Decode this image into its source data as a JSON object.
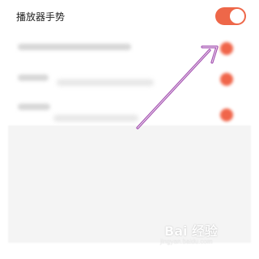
{
  "setting": {
    "title": "播放器手势",
    "toggle_on": true
  },
  "colors": {
    "accent": "#f0654a",
    "toggle_on": "#ee6749",
    "arrow": "#a34fb0"
  },
  "watermark": {
    "brand": "Bai  经验",
    "subtitle": "jingyan.baidu.com"
  }
}
